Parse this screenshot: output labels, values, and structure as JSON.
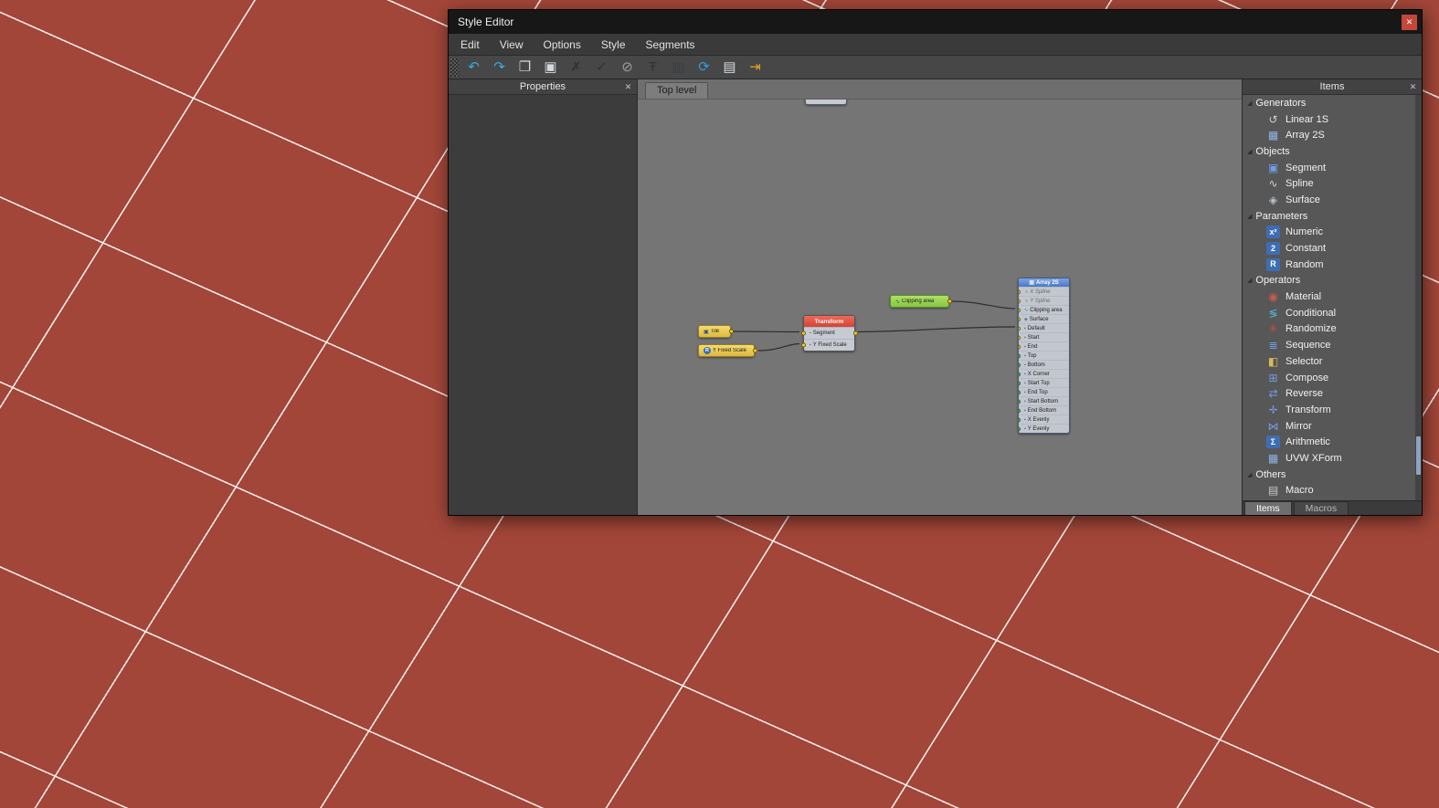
{
  "window": {
    "title": "Style Editor",
    "close_glyph": "✕"
  },
  "menu": {
    "items": [
      "Edit",
      "View",
      "Options",
      "Style",
      "Segments"
    ]
  },
  "toolbar": {
    "buttons": [
      {
        "name": "undo",
        "glyph": "↶",
        "color": "#3aa8e8"
      },
      {
        "name": "redo",
        "glyph": "↷",
        "color": "#3aa8e8"
      },
      {
        "name": "copy",
        "glyph": "❐",
        "color": "#d4dae0"
      },
      {
        "name": "paste",
        "glyph": "▣",
        "color": "#d4dae0"
      },
      {
        "name": "delete",
        "glyph": "✗",
        "color": "#2e3338"
      },
      {
        "name": "verify-style",
        "glyph": "✓",
        "color": "#2e3338"
      },
      {
        "name": "disable-node",
        "glyph": "⊘",
        "color": "#9aa0a6"
      },
      {
        "name": "arrange-nodes",
        "glyph": "Ŧ",
        "color": "#2e3338"
      },
      {
        "name": "remove-unused",
        "glyph": "▥",
        "color": "#3a4046"
      },
      {
        "name": "synchronize",
        "glyph": "⟳",
        "color": "#2e9de0"
      },
      {
        "name": "export-style",
        "glyph": "▤",
        "color": "#d4dae0"
      },
      {
        "name": "close-editor",
        "glyph": "⇥",
        "color": "#e8a020"
      }
    ]
  },
  "properties_panel": {
    "title": "Properties",
    "close_glyph": "✕"
  },
  "canvas": {
    "tab_label": "Top level"
  },
  "nodes": {
    "tile": {
      "label": "Tile",
      "icon_glyph": "▣"
    },
    "y_fixed_scale": {
      "label": "Y Fixed Scale",
      "icon_glyph": "R"
    },
    "transform": {
      "title": "Transform",
      "inputs": [
        {
          "label": "Segment",
          "glyph": "▪"
        },
        {
          "label": "Y Fixed Scale",
          "glyph": "▪"
        }
      ]
    },
    "clipping_area": {
      "label": "Clipping area",
      "icon_glyph": "∿"
    },
    "array_2s": {
      "title": "Array 2S",
      "icon_glyph": "▦",
      "rows": [
        {
          "label": "X Spline",
          "glyph": "∿",
          "port": "yellow",
          "dim": true
        },
        {
          "label": "Y Spline",
          "glyph": "∿",
          "port": "yellow",
          "dim": true
        },
        {
          "label": "Clipping area",
          "glyph": "∿",
          "port": "yellow"
        },
        {
          "label": "Surface",
          "glyph": "◈",
          "port": "yellow"
        },
        {
          "label": "Default",
          "glyph": "▪",
          "port": "yellow"
        },
        {
          "label": "Start",
          "glyph": "▪",
          "port": "yellow"
        },
        {
          "label": "End",
          "glyph": "▪",
          "port": "yellow"
        },
        {
          "label": "Top",
          "glyph": "▪",
          "port": "green"
        },
        {
          "label": "Bottom",
          "glyph": "▪",
          "port": "green"
        },
        {
          "label": "X Corner",
          "glyph": "▪",
          "port": "green"
        },
        {
          "label": "Start Top",
          "glyph": "▪",
          "port": "green"
        },
        {
          "label": "End Top",
          "glyph": "▪",
          "port": "green"
        },
        {
          "label": "Start Bottom",
          "glyph": "▪",
          "port": "green"
        },
        {
          "label": "End Bottom",
          "glyph": "▪",
          "port": "green"
        },
        {
          "label": "X Evenly",
          "glyph": "▪",
          "port": "green"
        },
        {
          "label": "Y Evenly",
          "glyph": "▪",
          "port": "green"
        }
      ]
    }
  },
  "items_panel": {
    "title": "Items",
    "close_glyph": "✕",
    "expand_glyph": "◢",
    "groups": [
      {
        "label": "Generators",
        "items": [
          {
            "label": "Linear 1S",
            "glyph": "↺",
            "fg": "#c8d2dc"
          },
          {
            "label": "Array 2S",
            "glyph": "▦",
            "fg": "#8fb4e8"
          }
        ]
      },
      {
        "label": "Objects",
        "items": [
          {
            "label": "Segment",
            "glyph": "▣",
            "fg": "#6f9fe8"
          },
          {
            "label": "Spline",
            "glyph": "∿",
            "fg": "#ccd2d8"
          },
          {
            "label": "Surface",
            "glyph": "◈",
            "fg": "#b8c2cc"
          }
        ]
      },
      {
        "label": "Parameters",
        "items": [
          {
            "label": "Numeric",
            "glyph": "x²",
            "fg": "#ffffff",
            "badge": true
          },
          {
            "label": "Constant",
            "glyph": "2",
            "fg": "#ffffff",
            "badge": true
          },
          {
            "label": "Random",
            "glyph": "R",
            "fg": "#ffffff",
            "badge": true
          }
        ]
      },
      {
        "label": "Operators",
        "items": [
          {
            "label": "Material",
            "glyph": "◉",
            "fg": "#cc5a4a"
          },
          {
            "label": "Conditional",
            "glyph": "≶",
            "fg": "#56b6d6"
          },
          {
            "label": "Randomize",
            "glyph": "✳",
            "fg": "#d84646"
          },
          {
            "label": "Sequence",
            "glyph": "≣",
            "fg": "#6f9fe8"
          },
          {
            "label": "Selector",
            "glyph": "◧",
            "fg": "#d8bc52"
          },
          {
            "label": "Compose",
            "glyph": "⊞",
            "fg": "#6f9fe8"
          },
          {
            "label": "Reverse",
            "glyph": "⇄",
            "fg": "#6f9fe8"
          },
          {
            "label": "Transform",
            "glyph": "✛",
            "fg": "#6f9fe8"
          },
          {
            "label": "Mirror",
            "glyph": "⋈",
            "fg": "#6f9fe8"
          },
          {
            "label": "Arithmetic",
            "glyph": "Σ",
            "fg": "#ffffff",
            "badge": true
          },
          {
            "label": "UVW XForm",
            "glyph": "▦",
            "fg": "#8fb4e8"
          }
        ]
      },
      {
        "label": "Others",
        "items": [
          {
            "label": "Macro",
            "glyph": "▤",
            "fg": "#c8c8c8"
          }
        ]
      }
    ],
    "tabs": [
      {
        "label": "Items"
      },
      {
        "label": "Macros"
      }
    ]
  }
}
